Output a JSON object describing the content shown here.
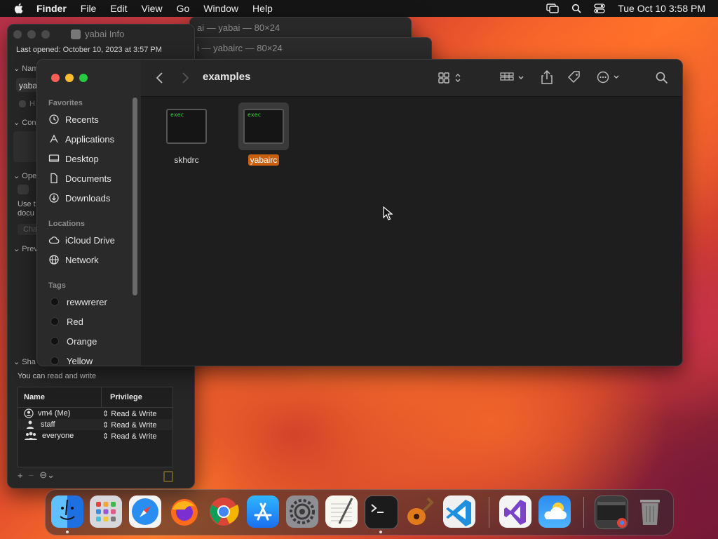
{
  "menubar": {
    "app_name": "Finder",
    "items": [
      "File",
      "Edit",
      "View",
      "Go",
      "Window",
      "Help"
    ],
    "datetime": "Tue Oct 10  3:58 PM",
    "icons": [
      "apple-icon",
      "screen-mirror-icon",
      "spotlight-icon",
      "control-center-icon"
    ]
  },
  "terminal_windows": [
    {
      "title": "ai — yabai — 80×24"
    },
    {
      "title": "i — yabairc — 80×24"
    }
  ],
  "info_window": {
    "title": "yabai Info",
    "last_opened": "Last opened: October 10, 2023 at 3:57 PM",
    "fragments": {
      "name_section": "Nam",
      "name_value": "yaba",
      "hide_ext": "H",
      "comments_section": "Con",
      "open_with_section": "Ope",
      "use_this": "Use t",
      "documents": "docu",
      "change_all": "Cha",
      "preview_section": "Prev",
      "sharing_section": "Sha"
    },
    "sharing_text": "You can read and write",
    "permissions": {
      "headers": [
        "Name",
        "Privilege"
      ],
      "rows": [
        {
          "name": "vm4 (Me)",
          "privilege": "Read & Write",
          "icon": "person-icon"
        },
        {
          "name": "staff",
          "privilege": "Read & Write",
          "icon": "group-icon"
        },
        {
          "name": "everyone",
          "privilege": "Read & Write",
          "icon": "everyone-icon"
        }
      ]
    },
    "tools": {
      "add": "+",
      "remove": "−",
      "action": "⊖⌄"
    }
  },
  "finder": {
    "folder_title": "examples",
    "sidebar": {
      "favorites_label": "Favorites",
      "favorites": [
        {
          "label": "Recents",
          "icon": "clock-icon"
        },
        {
          "label": "Applications",
          "icon": "applications-icon"
        },
        {
          "label": "Desktop",
          "icon": "desktop-icon"
        },
        {
          "label": "Documents",
          "icon": "document-icon"
        },
        {
          "label": "Downloads",
          "icon": "download-icon"
        }
      ],
      "locations_label": "Locations",
      "locations": [
        {
          "label": "iCloud Drive",
          "icon": "cloud-icon"
        },
        {
          "label": "Network",
          "icon": "globe-icon"
        }
      ],
      "tags_label": "Tags",
      "tags": [
        "rewwrerer",
        "Red",
        "Orange",
        "Yellow"
      ]
    },
    "files": [
      {
        "name": "skhdrc",
        "thumb_text": "exec",
        "selected": false
      },
      {
        "name": "yabairc",
        "thumb_text": "exec",
        "selected": true
      }
    ]
  },
  "dock": {
    "apps": [
      "Finder",
      "Launchpad",
      "Safari",
      "Firefox",
      "Chrome",
      "App Store",
      "System Settings",
      "TextEdit",
      "Terminal",
      "GarageBand",
      "Visual Studio Code",
      "Visual Studio",
      "Weather",
      "Chrome Window",
      "Trash"
    ]
  },
  "colors": {
    "selection": "#c8600f",
    "close": "#ff5f57",
    "minimize": "#febc2e",
    "zoom": "#28c840"
  }
}
